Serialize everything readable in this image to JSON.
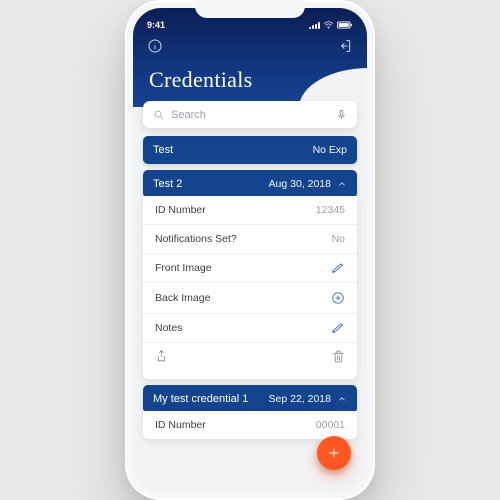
{
  "status": {
    "time": "9:41"
  },
  "page": {
    "title": "Credentials"
  },
  "search": {
    "placeholder": "Search"
  },
  "credentials": [
    {
      "name": "Test",
      "expiry": "No Exp",
      "expanded": false
    },
    {
      "name": "Test 2",
      "expiry": "Aug 30, 2018",
      "expanded": true,
      "fields": {
        "id_number": {
          "label": "ID Number",
          "value": "12345"
        },
        "notifications": {
          "label": "Notifications Set?",
          "value": "No"
        },
        "front_image": {
          "label": "Front Image"
        },
        "back_image": {
          "label": "Back Image"
        },
        "notes": {
          "label": "Notes"
        }
      }
    },
    {
      "name": "My test credential 1",
      "expiry": "Sep 22, 2018",
      "expanded": true,
      "fields": {
        "id_number": {
          "label": "ID Number",
          "value": "00001"
        }
      }
    }
  ],
  "colors": {
    "brand": "#15448f",
    "accent": "#ff5722"
  }
}
